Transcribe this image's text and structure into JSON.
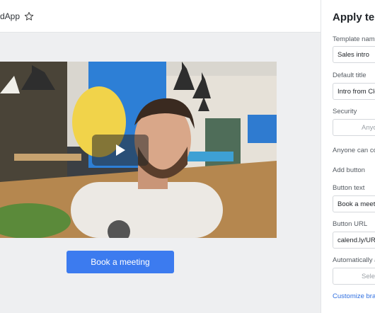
{
  "header": {
    "app_name": "dApp"
  },
  "video": {
    "play_label": "Play"
  },
  "cta": {
    "label": "Book a meeting"
  },
  "panel": {
    "title": "Apply tem",
    "template_name_label": "Template nam",
    "template_name_value": "Sales intro",
    "default_title_label": "Default title",
    "default_title_value": "Intro from Cle",
    "security_label": "Security",
    "security_value": "Anyo",
    "anyone_label": "Anyone can co",
    "add_button_label": "Add button",
    "button_text_label": "Button text",
    "button_text_value": "Book a meeti",
    "button_url_label": "Button URL",
    "button_url_value": "calend.ly/URL",
    "automatically_label": "Automatically a",
    "select_value": "Selec",
    "customize_link": "Customize bra"
  }
}
